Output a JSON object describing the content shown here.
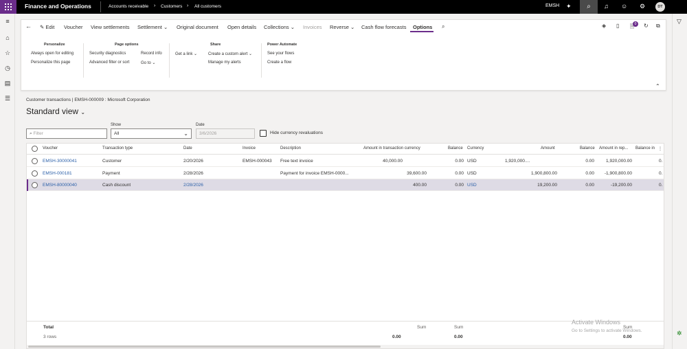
{
  "topbar": {
    "app_title": "Finance and Operations",
    "breadcrumbs": [
      "Accounts receivable",
      "Customers",
      "All customers"
    ],
    "company": "EMSH",
    "user_initials": "DT"
  },
  "toolbar": {
    "edit": "Edit",
    "voucher": "Voucher",
    "view_settlements": "View settlements",
    "settlement": "Settlement",
    "original_document": "Original document",
    "open_details": "Open details",
    "collections": "Collections",
    "invoices": "Invoices",
    "reverse": "Reverse",
    "cash_flow_forecasts": "Cash flow forecasts",
    "options": "Options",
    "notification_count": "0"
  },
  "ribbon": {
    "personalize": {
      "title": "Personalize",
      "items": [
        "Always open for editing",
        "Personalize this page"
      ]
    },
    "page_options": {
      "title": "Page options",
      "items": [
        "Security diagnostics",
        "Advanced filter or sort",
        "Record info",
        "Go to"
      ]
    },
    "share": {
      "title": "Share",
      "items": [
        "Get a link",
        "Create a custom alert",
        "Manage my alerts"
      ]
    },
    "power_automate": {
      "title": "Power Automate",
      "items": [
        "See your flows",
        "Create a flow"
      ]
    }
  },
  "context": "Customer transactions   |   EMSH-000009 : Microsoft Corporation",
  "view_title": "Standard view",
  "filters": {
    "filter_placeholder": "Filter",
    "show_label": "Show",
    "show_value": "All",
    "date_label": "Date",
    "date_value": "3/6/2026",
    "hide_reval_label": "Hide currency revaluations"
  },
  "grid": {
    "headers": [
      "Voucher",
      "Transaction type",
      "Date",
      "Invoice",
      "Description",
      "Amount in transaction currency",
      "Balance",
      "Currency",
      "Amount",
      "Balance",
      "Amount in rep...",
      "Balance in"
    ],
    "rows": [
      {
        "voucher": "EMSH-30000041",
        "type": "Customer",
        "date": "2/20/2026",
        "invoice": "EMSH-000043",
        "description": "Free text invoice",
        "amount_tc": "40,000.00",
        "balance": "0.00",
        "currency": "USD",
        "amount": "1,920,000....",
        "balance2": "0.00",
        "amount_rep": "1,920,000.00",
        "balance_in": "0."
      },
      {
        "voucher": "EMSH-000181",
        "type": "Payment",
        "date": "2/28/2026",
        "invoice": "",
        "description": "Payment for invoice EMSH-0000...",
        "amount_tc": "39,600.00",
        "balance": "0.00",
        "currency": "USD",
        "amount": "1,900,800.00",
        "balance2": "0.00",
        "amount_rep": "-1,900,800.00",
        "balance_in": "0."
      },
      {
        "voucher": "EMSH-80000040",
        "type": "Cash discount",
        "date": "2/28/2026",
        "invoice": "",
        "description": "",
        "amount_tc": "400.00",
        "balance": "0.00",
        "currency": "USD",
        "amount": "19,200.00",
        "balance2": "0.00",
        "amount_rep": "-19,200.00",
        "balance_in": "0."
      }
    ],
    "footer": {
      "total": "Total",
      "rows": "3 rows",
      "sum_label": "Sum",
      "sum1": "0.00",
      "sum2": "0.00",
      "sum3": "0.00"
    }
  },
  "watermark": {
    "title": "Activate Windows",
    "subtitle": "Go to Settings to activate Windows."
  }
}
